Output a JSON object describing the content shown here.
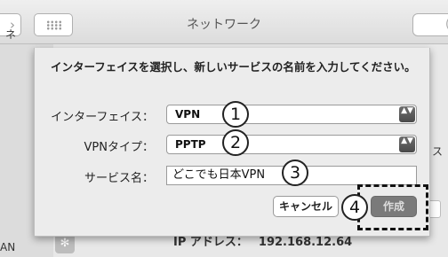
{
  "window": {
    "title": "ネットワーク"
  },
  "titlebar": {
    "back_arrow": "›",
    "search_glyph": "("
  },
  "background": {
    "left_label_ne": "ネ",
    "left_label_an": "AN",
    "bluetooth_glyph": "✻",
    "right_label_su": "ス",
    "ip_label": "IP アドレス：",
    "ip_value": "192.168.12.64"
  },
  "sheet": {
    "prompt": "インターフェイスを選択し、新しいサービスの名前を入力してください。",
    "interface_label": "インターフェイス：",
    "interface_value": "VPN",
    "vpn_type_label": "VPNタイプ：",
    "vpn_type_value": "PPTP",
    "service_name_label": "サービス名：",
    "service_name_value": "どこでも日本VPN",
    "cancel_label": "キャンセル",
    "create_label": "作成",
    "popup_arrows": "▲▼"
  },
  "callouts": [
    "1",
    "2",
    "3",
    "4"
  ]
}
